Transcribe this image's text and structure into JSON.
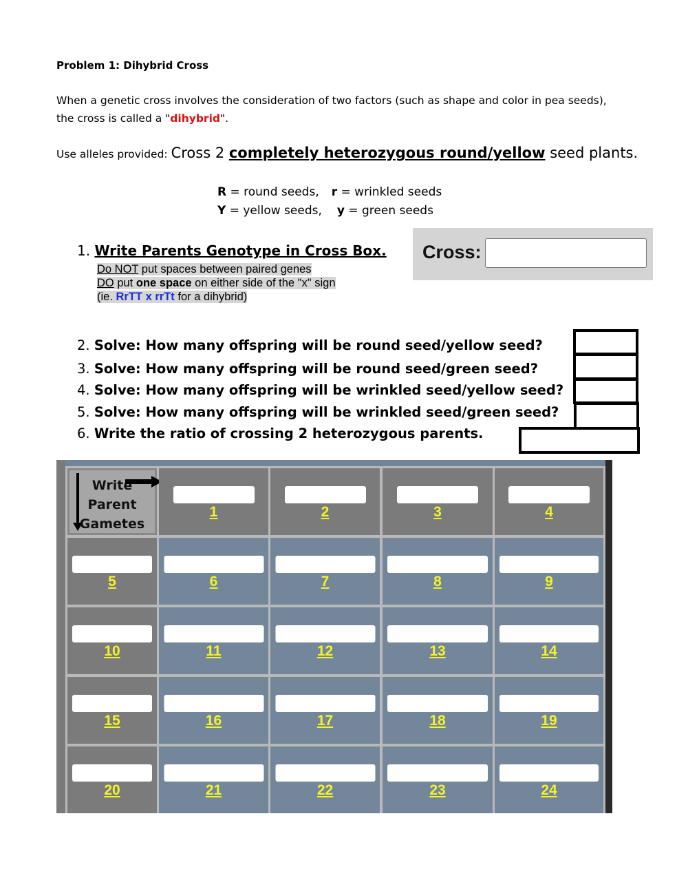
{
  "title": "Problem 1: Dihybrid Cross",
  "intro": {
    "before": "When a genetic cross involves the consideration of two factors (such as shape and color in pea seeds), the cross is called a \"",
    "keyword": "dihybrid",
    "after": "\"."
  },
  "instruction": {
    "prefix": "Use alleles provided: ",
    "cross_text": "Cross 2 ",
    "emphasis": "completely heterozygous round/yellow",
    "suffix": " seed plants."
  },
  "alleles": [
    {
      "sym1": "R",
      "desc1": " = round seeds,",
      "sym2": "r",
      "desc2": " = wrinkled seeds"
    },
    {
      "sym1": "Y",
      "desc1": " = yellow seeds,",
      "sym2": "y",
      "desc2": " = green seeds"
    }
  ],
  "question1": {
    "number": "1.",
    "text": "Write Parents Genotype in Cross Box.",
    "notes": {
      "line1_u": "Do NOT",
      "line1_rest": " put spaces between paired genes",
      "line2_u": "DO",
      "line2_mid": " put ",
      "line2_bold": "one space",
      "line2_rest": " on either side of the \"x\" sign",
      "line3_start": "(ie. ",
      "line3_example": "RrTT x rrTt",
      "line3_end": " for a dihybrid)"
    }
  },
  "cross_box": {
    "label": "Cross:",
    "value": ""
  },
  "questions": [
    {
      "number": "2.",
      "bold": "Solve: How many offspring will be round seed/yellow seed?",
      "answer": ""
    },
    {
      "number": "3.",
      "bold": "Solve: How many offspring will be round seed/green seed?",
      "answer": ""
    },
    {
      "number": "4.",
      "bold": "Solve: How many offspring will be wrinkled seed/yellow seed?",
      "answer": ""
    },
    {
      "number": "5.",
      "bold": "Solve: How many offspring will be wrinkled seed/green seed?",
      "answer": ""
    },
    {
      "number": "6.",
      "bold": "Write the ratio of crossing 2 heterozygous parents.",
      "answer": ""
    }
  ],
  "punnett": {
    "corner_label": [
      "Write",
      "Parent",
      "Gametes"
    ],
    "cells": [
      "1",
      "2",
      "3",
      "4",
      "5",
      "6",
      "7",
      "8",
      "9",
      "10",
      "11",
      "12",
      "13",
      "14",
      "15",
      "16",
      "17",
      "18",
      "19",
      "20",
      "21",
      "22",
      "23",
      "24"
    ]
  },
  "colors": {
    "keyword_red": "#e01010",
    "example_blue": "#1a2fd8",
    "cell_label_yellow": "#f5f32a",
    "gamete_cell_gray": "#7b7b7b",
    "offspring_cell_blue": "#73869a"
  }
}
